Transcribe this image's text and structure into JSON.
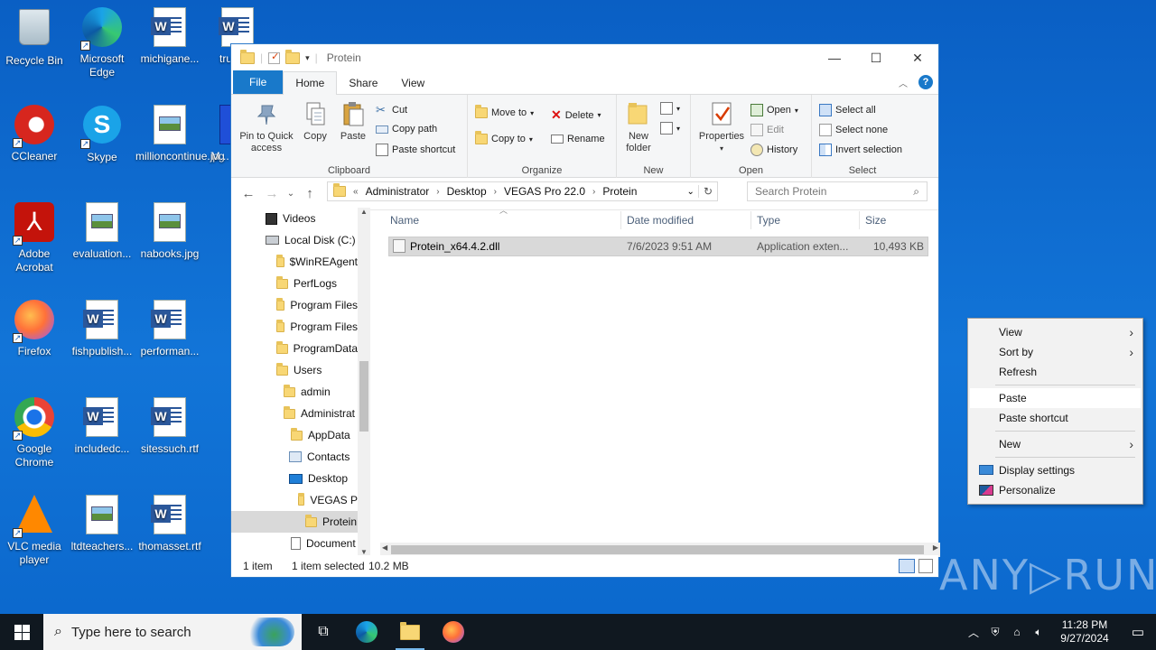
{
  "desktop": {
    "icons": [
      {
        "label": "Recycle Bin",
        "icon": "recycle-bin-icon"
      },
      {
        "label": "Microsoft Edge",
        "icon": "edge-icon"
      },
      {
        "label": "michigane...",
        "icon": "word-doc-icon"
      },
      {
        "label": "truste...",
        "icon": "word-doc-icon"
      },
      {
        "label": "CCleaner",
        "icon": "ccleaner-icon"
      },
      {
        "label": "Skype",
        "icon": "skype-icon"
      },
      {
        "label": "millioncontinue.jpg",
        "icon": "image-file-icon"
      },
      {
        "label": "M... VEG...",
        "icon": "app-icon"
      },
      {
        "label": "Adobe Acrobat",
        "icon": "acrobat-icon"
      },
      {
        "label": "evaluation...",
        "icon": "image-file-icon"
      },
      {
        "label": "nabooks.jpg",
        "icon": "image-file-icon"
      },
      {
        "label": "Firefox",
        "icon": "firefox-icon"
      },
      {
        "label": "fishpublish...",
        "icon": "word-doc-icon"
      },
      {
        "label": "performan...",
        "icon": "word-doc-icon"
      },
      {
        "label": "Google Chrome",
        "icon": "chrome-icon"
      },
      {
        "label": "includedc...",
        "icon": "word-doc-icon"
      },
      {
        "label": "sitessuch.rtf",
        "icon": "word-doc-icon"
      },
      {
        "label": "VLC media player",
        "icon": "vlc-icon"
      },
      {
        "label": "ltdteachers...",
        "icon": "image-file-icon"
      },
      {
        "label": "thomasset.rtf",
        "icon": "word-doc-icon"
      }
    ]
  },
  "explorer": {
    "title": "Protein",
    "tabs": [
      "File",
      "Home",
      "Share",
      "View"
    ],
    "ribbon": {
      "clipboard": {
        "label": "Clipboard",
        "pin": "Pin to Quick access",
        "copy": "Copy",
        "paste": "Paste",
        "cut": "Cut",
        "copy_path": "Copy path",
        "paste_shortcut": "Paste shortcut"
      },
      "organize": {
        "label": "Organize",
        "move_to": "Move to",
        "copy_to": "Copy to",
        "delete": "Delete",
        "rename": "Rename"
      },
      "new": {
        "label": "New",
        "new_folder": "New folder"
      },
      "open": {
        "label": "Open",
        "properties": "Properties",
        "open": "Open",
        "edit": "Edit",
        "history": "History"
      },
      "select": {
        "label": "Select",
        "select_all": "Select all",
        "select_none": "Select none",
        "invert": "Invert selection"
      }
    },
    "address": {
      "prefix": "«",
      "crumbs": [
        "Administrator",
        "Desktop",
        "VEGAS Pro 22.0",
        "Protein"
      ]
    },
    "search_placeholder": "Search Protein",
    "nav": [
      "Videos",
      "Local Disk (C:)",
      "$WinREAgent",
      "PerfLogs",
      "Program Files",
      "Program Files",
      "ProgramData",
      "Users",
      "admin",
      "Administrat",
      "AppData",
      "Contacts",
      "Desktop",
      "VEGAS P",
      "Protein",
      "Document"
    ],
    "columns": {
      "name": "Name",
      "date": "Date modified",
      "type": "Type",
      "size": "Size"
    },
    "files": [
      {
        "name": "Protein_x64.4.2.dll",
        "date": "7/6/2023 9:51 AM",
        "type": "Application exten...",
        "size": "10,493 KB"
      }
    ],
    "status": {
      "count": "1 item",
      "selected": "1 item selected",
      "size": "10.2 MB"
    }
  },
  "context_menu": {
    "view": "View",
    "sort_by": "Sort by",
    "refresh": "Refresh",
    "paste": "Paste",
    "paste_shortcut": "Paste shortcut",
    "new": "New",
    "display_settings": "Display settings",
    "personalize": "Personalize"
  },
  "watermark": "ANY▷RUN",
  "taskbar": {
    "search_placeholder": "Type here to search",
    "time": "11:28 PM",
    "date": "9/27/2024"
  }
}
